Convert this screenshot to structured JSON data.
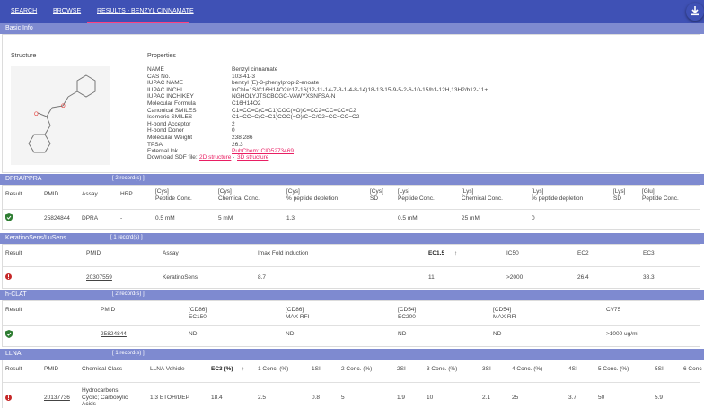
{
  "nav": {
    "tabs": [
      "SEARCH",
      "BROWSE",
      "RESULTS - BENZYL CINNAMATE"
    ],
    "download_icon": "download-icon",
    "colors": {
      "bar": "#3f51b5",
      "active_underline": "#ff4081",
      "section": "#7e8ad0",
      "link": "#e91e63"
    }
  },
  "basic_info": {
    "section_title": "Basic Info",
    "structure_label": "Structure",
    "properties_label": "Properties",
    "props": [
      {
        "label": "NAME",
        "value": "Benzyl cinnamate"
      },
      {
        "label": "CAS No.",
        "value": "103-41-3"
      },
      {
        "label": "IUPAC NAME",
        "value": "benzyl (E)-3-phenylprop-2-enoate"
      },
      {
        "label": "IUPAC INCHI",
        "value": "InChI=1S/C16H14O2/c17-16(12-11-14-7-3-1-4-8-14)18-13-15-9-5-2-6-10-15/h1-12H,13H2/b12-11+"
      },
      {
        "label": "IUPAC INCHIKEY",
        "value": "NGHOLYJTSCBCGC-VAWYXSNFSA-N"
      },
      {
        "label": "Molecular Formula",
        "value": "C16H14O2"
      },
      {
        "label": "Canonical SMILES",
        "value": "C1=CC=C(C=C1)COC(=O)C=CC2=CC=CC=C2"
      },
      {
        "label": "Isomeric SMILES",
        "value": "C1=CC=C(C=C1)COC(=O)/C=C/C2=CC=CC=C2"
      },
      {
        "label": "H-bond Acceptor",
        "value": "2"
      },
      {
        "label": "H-bond Donor",
        "value": "0"
      },
      {
        "label": "Molecular Weight",
        "value": "238.286"
      },
      {
        "label": "TPSA",
        "value": "26.3"
      }
    ],
    "external_lnk_label": "External lnk",
    "external_lnk_value": "PubChem: CID5273469",
    "download_label": "Download SDF file:",
    "sdf_2d": "2D structure",
    "sdf_sep": "-",
    "sdf_3d": "3D structure"
  },
  "dpra": {
    "title": "DPRA/PPRA",
    "count": "[ 2 record(s) ]",
    "headers": [
      "Result",
      "PMID",
      "Assay",
      "HRP",
      "[Cys]\nPeptide Conc.",
      "[Cys]\nChemical Conc.",
      "[Cys]\n% peptide depletion",
      "[Cys]\nSD",
      "[Lys]\nPeptide Conc.",
      "[Lys]\nChemical Conc.",
      "[Lys]\n% peptide depletion",
      "[Lys]\nSD",
      "[Glu]\nPeptide Conc."
    ],
    "row": [
      "25824844",
      "DPRA",
      "-",
      "0.5 mM",
      "5 mM",
      "1.3",
      "",
      "0.5 mM",
      "25 mM",
      "0",
      "",
      ""
    ]
  },
  "keratino": {
    "title": "KeratinoSens/LuSens",
    "count": "[ 1 record(s) ]",
    "headers": [
      "Result",
      "PMID",
      "Assay",
      "Imax Fold induction",
      "EC1.5",
      "IC50",
      "EC2",
      "EC3"
    ],
    "sort_arrow": "↑",
    "row": [
      "20307559",
      "KeratinoSens",
      "8.7",
      "11",
      ">2000",
      "26.4",
      "38.3"
    ]
  },
  "hclat": {
    "title": "h-CLAT",
    "count": "[ 2 record(s) ]",
    "headers": [
      "Result",
      "PMID",
      "[CD86]\nEC150",
      "[CD86]\nMAX RFI",
      "[CD54]\nEC200",
      "[CD54]\nMAX RFI",
      "CV75"
    ],
    "row": [
      "25824844",
      "ND",
      "ND",
      "ND",
      "ND",
      ">1000 ug/ml"
    ]
  },
  "llna": {
    "title": "LLNA",
    "count": "[ 1 record(s) ]",
    "headers": [
      "Result",
      "PMID",
      "Chemical Class",
      "LLNA Vehicle",
      "EC3 (%)",
      "1 Conc. (%)",
      "1SI",
      "2 Conc. (%)",
      "2SI",
      "3 Conc. (%)",
      "3SI",
      "4 Conc. (%)",
      "4SI",
      "5 Conc. (%)",
      "5SI",
      "6 Conc"
    ],
    "sort_arrow": "↑",
    "row": {
      "pmid": "20137736",
      "chem_class": [
        "Hydrocarbons,",
        "Cyclic; Carboxylic",
        "Acids"
      ],
      "vehicle": "1:3 ETOH/DEP",
      "values": [
        "18.4",
        "2.5",
        "0.8",
        "5",
        "1.9",
        "10",
        "2.1",
        "25",
        "3.7",
        "50",
        "5.9"
      ]
    }
  }
}
